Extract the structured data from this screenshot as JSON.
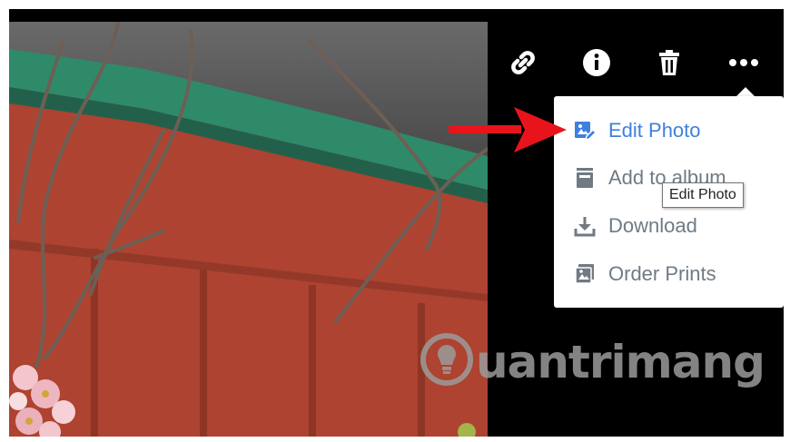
{
  "toolbar": {
    "icons": [
      "link-icon",
      "info-icon",
      "trash-icon",
      "more-icon"
    ]
  },
  "menu": {
    "items": [
      {
        "label": "Edit Photo",
        "icon": "edit-photo-icon",
        "active": true
      },
      {
        "label": "Add to album",
        "icon": "album-icon",
        "active": false
      },
      {
        "label": "Download",
        "icon": "download-icon",
        "active": false
      },
      {
        "label": "Order Prints",
        "icon": "prints-icon",
        "active": false
      }
    ]
  },
  "tooltip": {
    "text": "Edit Photo"
  },
  "watermark": {
    "text": "uantrimang"
  },
  "colors": {
    "accent": "#3f7fe0",
    "menu_text": "#6f7a84",
    "arrow": "#e8141b"
  }
}
